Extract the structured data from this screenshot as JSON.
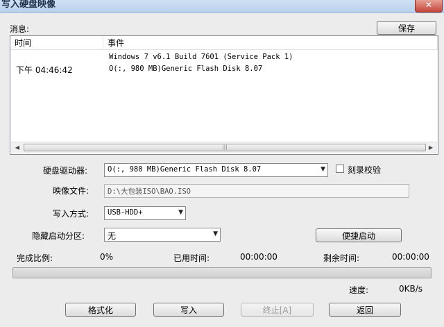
{
  "window": {
    "title": "写入硬盘映像",
    "close_glyph": "✕"
  },
  "messages": {
    "label": "消息:",
    "save_button": "保存",
    "columns": [
      "时间",
      "事件"
    ],
    "rows": [
      {
        "time": "",
        "event": "Windows 7 v6.1 Build 7601 (Service Pack 1)"
      },
      {
        "time": "下午 04:46:42",
        "event": "O(:, 980 MB)Generic Flash Disk       8.07"
      }
    ]
  },
  "form": {
    "drive_label": "硬盘驱动器:",
    "drive_value": "O(:, 980 MB)Generic Flash Disk      8.07",
    "verify_label": "刻录校验",
    "verify_checked": false,
    "image_label": "映像文件:",
    "image_value": "D:\\大包装ISO\\BAO.ISO",
    "write_mode_label": "写入方式:",
    "write_mode_value": "USB-HDD+",
    "hidden_partition_label": "隐藏启动分区:",
    "hidden_partition_value": "无",
    "quick_boot_button": "便捷启动"
  },
  "status": {
    "complete_label": "完成比例:",
    "complete_value": "0%",
    "progress_fraction": 0,
    "elapsed_label": "已用时间:",
    "elapsed_value": "00:00:00",
    "remaining_label": "剩余时间:",
    "remaining_value": "00:00:00",
    "speed_label": "速度:",
    "speed_value": "0KB/s"
  },
  "buttons": {
    "format": "格式化",
    "write": "写入",
    "stop": "终止[A]",
    "back": "返回"
  },
  "icons": {
    "dropdown": "chevron-down-icon",
    "scroll_left": "arrow-left-icon",
    "scroll_right": "arrow-right-icon"
  },
  "colors": {
    "progress_fill": "#37b34a",
    "titlebar": "#b9d1ee"
  }
}
